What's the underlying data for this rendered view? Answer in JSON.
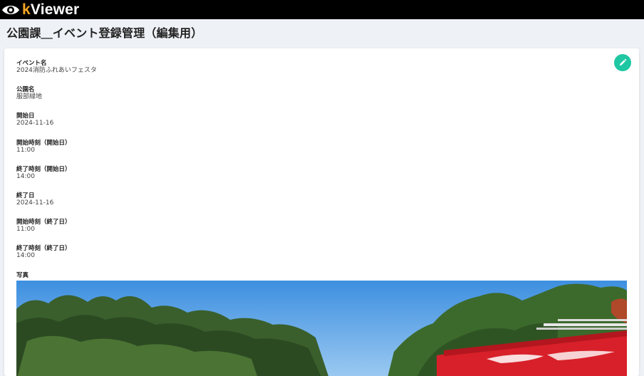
{
  "app": {
    "logo_icon": "eye-icon",
    "logo_prefix": "k",
    "logo_name": "Viewer"
  },
  "page": {
    "title": "公園課＿イベント登録管理（編集用）"
  },
  "record": {
    "edit_icon": "pencil-icon",
    "fields": [
      {
        "label": "イベント名",
        "value": "2024消防ふれあいフェスタ"
      },
      {
        "label": "公園名",
        "value": "服部緑地"
      },
      {
        "label": "開始日",
        "value": "2024-11-16"
      },
      {
        "label": "開始時刻（開始日）",
        "value": "11:00"
      },
      {
        "label": "終了時刻（開始日）",
        "value": "14:00"
      },
      {
        "label": "終了日",
        "value": "2024-11-16"
      },
      {
        "label": "開始時刻（終了日）",
        "value": "11:00"
      },
      {
        "label": "終了時刻（終了日）",
        "value": "14:00"
      }
    ],
    "photo_label": "写真"
  },
  "colors": {
    "topbar": "#000000",
    "logo_accent": "#f5a623",
    "edit_button": "#1fc7a3",
    "background": "#eef1f6"
  }
}
